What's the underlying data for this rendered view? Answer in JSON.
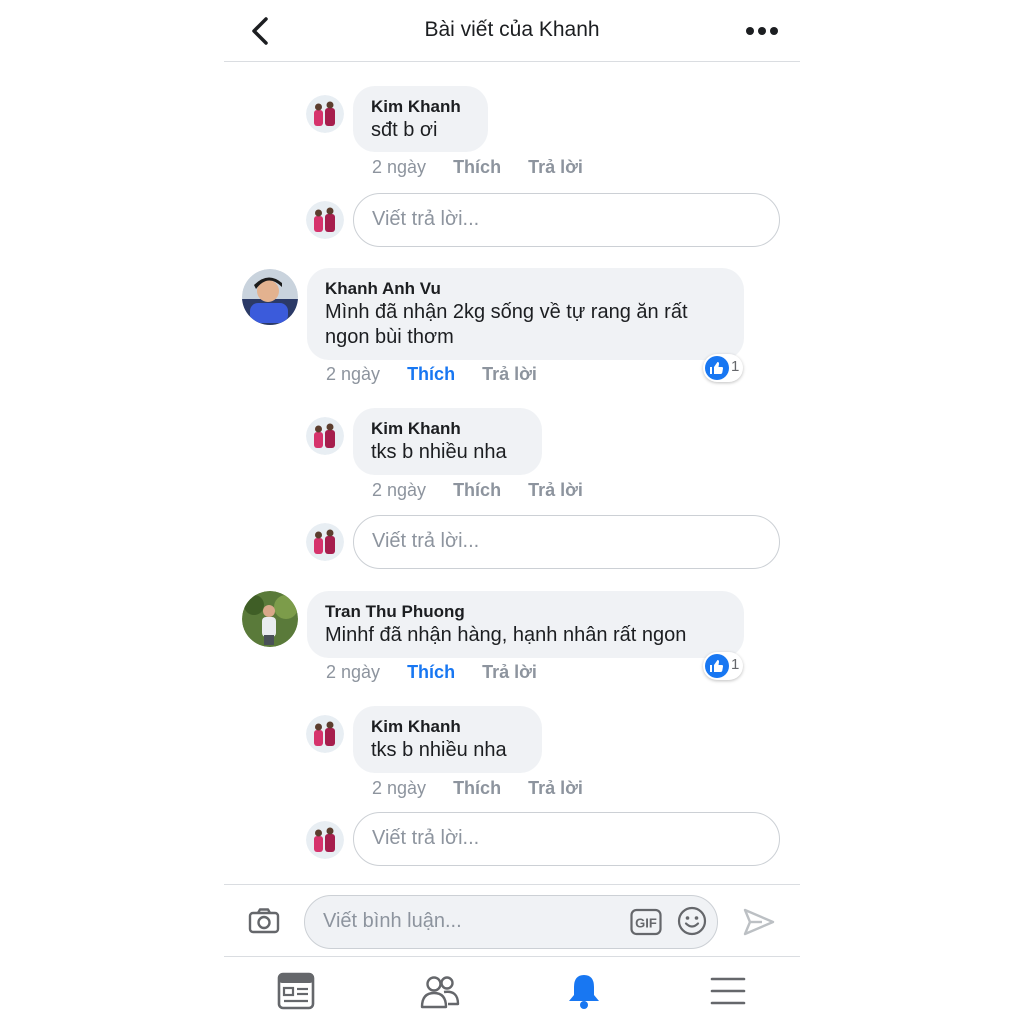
{
  "header": {
    "title": "Bài viết của Khanh",
    "back_icon": "chevron-left-icon",
    "more_icon": "more-dots-icon"
  },
  "comments": [
    {
      "author": "Kim Khanh",
      "text": "sđt b ơi",
      "time": "2 ngày",
      "like_label": "Thích",
      "reply_label": "Trả lời",
      "liked": false,
      "is_reply": true
    },
    {
      "author": "Khanh Anh Vu",
      "text_line1": "Mình đã nhận 2kg sống về tự rang ăn rất",
      "text_line2": "ngon bùi thơm",
      "time": "2 ngày",
      "like_label": "Thích",
      "reply_label": "Trả lời",
      "liked": true,
      "reaction_count": "1",
      "is_reply": false
    },
    {
      "author": "Kim Khanh",
      "text": "tks b nhiều nha",
      "time": "2 ngày",
      "like_label": "Thích",
      "reply_label": "Trả lời",
      "liked": false,
      "is_reply": true
    },
    {
      "author": "Tran Thu Phuong",
      "text": "Minhf đã nhận hàng, hạnh nhân rất ngon",
      "time": "2 ngày",
      "like_label": "Thích",
      "reply_label": "Trả lời",
      "liked": true,
      "reaction_count": "1",
      "is_reply": false
    },
    {
      "author": "Kim Khanh",
      "text": "tks b nhiều nha",
      "time": "2 ngày",
      "like_label": "Thích",
      "reply_label": "Trả lời",
      "liked": false,
      "is_reply": true
    }
  ],
  "reply_placeholder": "Viết trả lời...",
  "composer": {
    "placeholder": "Viết bình luận...",
    "gif_label": "GIF",
    "camera_icon": "camera-icon",
    "emoji_icon": "emoji-icon",
    "send_icon": "send-icon"
  },
  "tabbar": {
    "items": [
      {
        "icon": "news-feed-icon",
        "active": false
      },
      {
        "icon": "friends-icon",
        "active": false
      },
      {
        "icon": "notifications-bell-icon",
        "active": true
      },
      {
        "icon": "menu-icon",
        "active": false
      }
    ]
  },
  "colors": {
    "accent": "#1877f2",
    "bubble": "#f0f2f5",
    "muted_text": "#8d949e",
    "divider": "#dadde1"
  }
}
